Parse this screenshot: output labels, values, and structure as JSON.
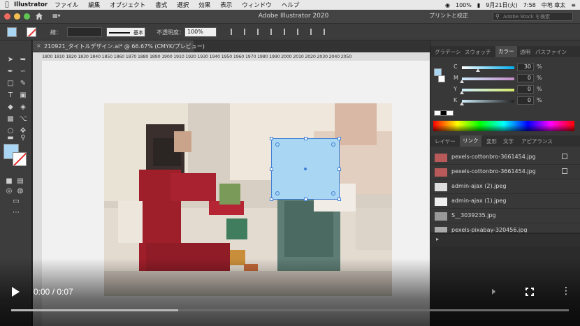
{
  "menubar": {
    "app_name": "Illustrator",
    "items": [
      "ファイル",
      "編集",
      "オブジェクト",
      "書式",
      "選択",
      "効果",
      "表示",
      "ウィンドウ",
      "ヘルプ"
    ],
    "battery": "100%",
    "date": "9月21日(火)",
    "time": "7:58",
    "user": "中地 章太"
  },
  "titlebar": {
    "title": "Adobe Illustrator 2020",
    "print_label": "プリントと校正",
    "stock_placeholder": "Adobe Stock を検索"
  },
  "controlbar": {
    "stroke_label": "線：",
    "brush_label": "基本",
    "opacity_label": "不透明度：",
    "opacity_value": "100%",
    "fill_color": "#a9d6f2"
  },
  "document": {
    "tab_title": "210921_タイトルデザイン.ai* @ 66.67% (CMYK/プレビュー)",
    "ruler_numbers": "1800 1810 1820 1830 1840 1850 1860 1870 1880 1890 1900 1910 1920 1930 1940 1950 1960 1970 1980 1990 2000 2010 2020 2030 2040 2050"
  },
  "color_panel": {
    "tabs": [
      "グラデーシ",
      "スウォッチ",
      "カラー",
      "透明",
      "パスファイン"
    ],
    "active_tab": "カラー",
    "channels": [
      {
        "label": "C",
        "value": "30",
        "unit": "%"
      },
      {
        "label": "M",
        "value": "0",
        "unit": "%"
      },
      {
        "label": "Y",
        "value": "0",
        "unit": "%"
      },
      {
        "label": "K",
        "value": "0",
        "unit": "%"
      }
    ]
  },
  "links_panel": {
    "tabs": [
      "レイヤー",
      "リンク",
      "変形",
      "文字",
      "アピアランス"
    ],
    "active_tab": "リンク",
    "items": [
      {
        "name": "pexels-cottonbro-3661454.jpg"
      },
      {
        "name": "pexels-cottonbro-3661454.jpg"
      },
      {
        "name": "admin-ajax (2).jpeg"
      },
      {
        "name": "admin-ajax (1).jpeg"
      },
      {
        "name": "S__3039235.jpg"
      },
      {
        "name": "pexels-pixabay-320456.jpg"
      }
    ]
  },
  "video": {
    "time": "0:00 / 0:07",
    "buffered_fraction": 0.3
  }
}
